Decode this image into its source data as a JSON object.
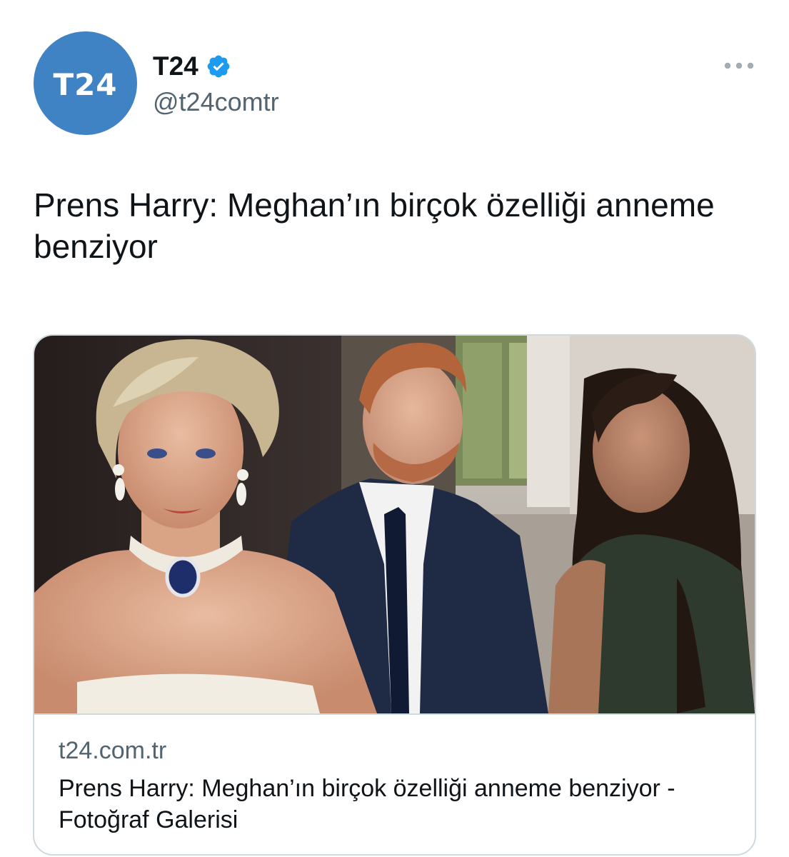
{
  "author": {
    "avatar_text": "T24",
    "display_name": "T24",
    "handle": "@t24comtr",
    "verified": true
  },
  "icons": {
    "verified": "verified-badge-icon",
    "more": "more-options-icon"
  },
  "tweet": {
    "text": "Prens Harry: Meghan’ın birçok özelliği anneme benziyor"
  },
  "card": {
    "domain": "t24.com.tr",
    "title": "Prens Harry: Meghan’ın birçok özelliği anneme benziyor - Fotoğraf Galerisi"
  },
  "colors": {
    "avatar_bg": "#3f83c5",
    "verified_blue": "#1d9bf0",
    "secondary_text": "#536471",
    "border": "#cfd9de"
  }
}
